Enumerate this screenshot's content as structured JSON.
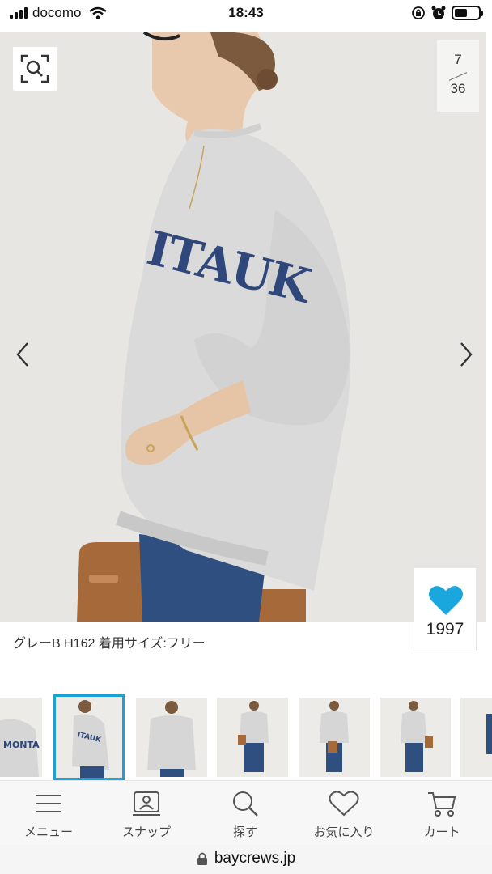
{
  "status_bar": {
    "carrier": "docomo",
    "time": "18:43",
    "battery_level": 0.55
  },
  "product": {
    "page_current": "7",
    "page_total": "36",
    "caption": "グレーB H162 着用サイズ:フリー",
    "like_count": "1997",
    "sweatshirt_print": "ITAUK",
    "colors": {
      "accent": "#1ba2d4",
      "heart": "#1aa7de"
    }
  },
  "thumbnails": {
    "count": 7,
    "selected_index": 1
  },
  "bottom_nav": {
    "items": [
      {
        "label": "メニュー",
        "icon": "menu-icon"
      },
      {
        "label": "スナップ",
        "icon": "snap-icon"
      },
      {
        "label": "探す",
        "icon": "search-icon"
      },
      {
        "label": "お気に入り",
        "icon": "heart-outline-icon"
      },
      {
        "label": "カート",
        "icon": "cart-icon"
      }
    ]
  },
  "browser": {
    "url": "baycrews.jp"
  }
}
